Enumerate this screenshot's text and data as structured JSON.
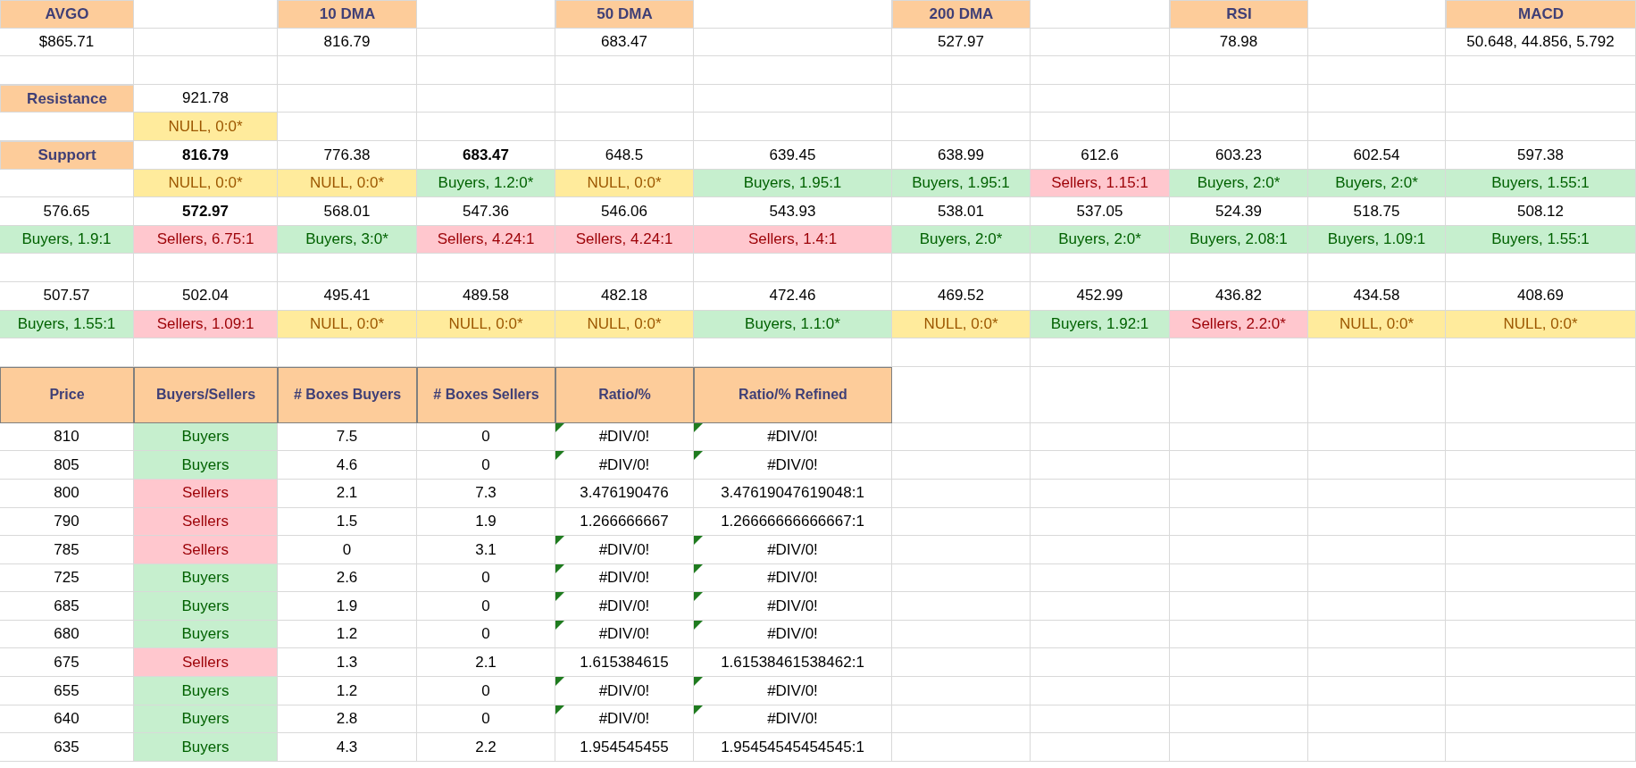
{
  "grid_rows": [
    {
      "cells": [
        {
          "text": "AVGO",
          "kind": "header"
        },
        null,
        {
          "text": "10 DMA",
          "kind": "header"
        },
        null,
        {
          "text": "50 DMA",
          "kind": "header"
        },
        null,
        {
          "text": "200 DMA",
          "kind": "header"
        },
        null,
        {
          "text": "RSI",
          "kind": "header"
        },
        null,
        {
          "text": "MACD",
          "kind": "header"
        }
      ]
    },
    {
      "cells": [
        {
          "text": "$865.71",
          "kind": "plain"
        },
        null,
        {
          "text": "816.79",
          "kind": "plain"
        },
        null,
        {
          "text": "683.47",
          "kind": "plain"
        },
        null,
        {
          "text": "527.97",
          "kind": "plain"
        },
        null,
        {
          "text": "78.98",
          "kind": "plain"
        },
        null,
        {
          "text": "50.648, 44.856, 5.792",
          "kind": "plain"
        }
      ]
    },
    {
      "cells": [
        null,
        null,
        null,
        null,
        null,
        null,
        null,
        null,
        null,
        null,
        null
      ]
    },
    {
      "cells": [
        {
          "text": "Resistance",
          "kind": "header"
        },
        {
          "text": "921.78",
          "kind": "plain"
        },
        null,
        null,
        null,
        null,
        null,
        null,
        null,
        null,
        null
      ]
    },
    {
      "cells": [
        null,
        {
          "text": "NULL, 0:0*",
          "kind": "neutral"
        },
        null,
        null,
        null,
        null,
        null,
        null,
        null,
        null,
        null
      ]
    },
    {
      "cells": [
        {
          "text": "Support",
          "kind": "header"
        },
        {
          "text": "816.79",
          "kind": "bold"
        },
        {
          "text": "776.38",
          "kind": "plain"
        },
        {
          "text": "683.47",
          "kind": "bold"
        },
        {
          "text": "648.5",
          "kind": "plain"
        },
        {
          "text": "639.45",
          "kind": "plain"
        },
        {
          "text": "638.99",
          "kind": "plain"
        },
        {
          "text": "612.6",
          "kind": "plain"
        },
        {
          "text": "603.23",
          "kind": "plain"
        },
        {
          "text": "602.54",
          "kind": "plain"
        },
        {
          "text": "597.38",
          "kind": "plain"
        }
      ]
    },
    {
      "cells": [
        null,
        {
          "text": "NULL, 0:0*",
          "kind": "neutral"
        },
        {
          "text": "NULL, 0:0*",
          "kind": "neutral"
        },
        {
          "text": "Buyers, 1.2:0*",
          "kind": "buyers"
        },
        {
          "text": "NULL, 0:0*",
          "kind": "neutral"
        },
        {
          "text": "Buyers, 1.95:1",
          "kind": "buyers"
        },
        {
          "text": "Buyers, 1.95:1",
          "kind": "buyers"
        },
        {
          "text": "Sellers, 1.15:1",
          "kind": "sellers"
        },
        {
          "text": "Buyers, 2:0*",
          "kind": "buyers"
        },
        {
          "text": "Buyers, 2:0*",
          "kind": "buyers"
        },
        {
          "text": "Buyers, 1.55:1",
          "kind": "buyers"
        }
      ]
    },
    {
      "cells": [
        {
          "text": "576.65",
          "kind": "plain"
        },
        {
          "text": "572.97",
          "kind": "bold"
        },
        {
          "text": "568.01",
          "kind": "plain"
        },
        {
          "text": "547.36",
          "kind": "plain"
        },
        {
          "text": "546.06",
          "kind": "plain"
        },
        {
          "text": "543.93",
          "kind": "plain"
        },
        {
          "text": "538.01",
          "kind": "plain"
        },
        {
          "text": "537.05",
          "kind": "plain"
        },
        {
          "text": "524.39",
          "kind": "plain"
        },
        {
          "text": "518.75",
          "kind": "plain"
        },
        {
          "text": "508.12",
          "kind": "plain"
        }
      ]
    },
    {
      "cells": [
        {
          "text": "Buyers, 1.9:1",
          "kind": "buyers"
        },
        {
          "text": "Sellers, 6.75:1",
          "kind": "sellers"
        },
        {
          "text": "Buyers, 3:0*",
          "kind": "buyers"
        },
        {
          "text": "Sellers, 4.24:1",
          "kind": "sellers"
        },
        {
          "text": "Sellers, 4.24:1",
          "kind": "sellers"
        },
        {
          "text": "Sellers, 1.4:1",
          "kind": "sellers"
        },
        {
          "text": "Buyers, 2:0*",
          "kind": "buyers"
        },
        {
          "text": "Buyers, 2:0*",
          "kind": "buyers"
        },
        {
          "text": "Buyers, 2.08:1",
          "kind": "buyers"
        },
        {
          "text": "Buyers, 1.09:1",
          "kind": "buyers"
        },
        {
          "text": "Buyers, 1.55:1",
          "kind": "buyers"
        }
      ]
    },
    {
      "cells": [
        null,
        null,
        null,
        null,
        null,
        null,
        null,
        null,
        null,
        null,
        null
      ]
    },
    {
      "cells": [
        {
          "text": "507.57",
          "kind": "plain"
        },
        {
          "text": "502.04",
          "kind": "plain"
        },
        {
          "text": "495.41",
          "kind": "plain"
        },
        {
          "text": "489.58",
          "kind": "plain"
        },
        {
          "text": "482.18",
          "kind": "plain"
        },
        {
          "text": "472.46",
          "kind": "plain"
        },
        {
          "text": "469.52",
          "kind": "plain"
        },
        {
          "text": "452.99",
          "kind": "plain"
        },
        {
          "text": "436.82",
          "kind": "plain"
        },
        {
          "text": "434.58",
          "kind": "plain"
        },
        {
          "text": "408.69",
          "kind": "plain"
        }
      ]
    },
    {
      "cells": [
        {
          "text": "Buyers, 1.55:1",
          "kind": "buyers"
        },
        {
          "text": "Sellers, 1.09:1",
          "kind": "sellers"
        },
        {
          "text": "NULL, 0:0*",
          "kind": "neutral"
        },
        {
          "text": "NULL, 0:0*",
          "kind": "neutral"
        },
        {
          "text": "NULL, 0:0*",
          "kind": "neutral"
        },
        {
          "text": "Buyers, 1.1:0*",
          "kind": "buyers"
        },
        {
          "text": "NULL, 0:0*",
          "kind": "neutral"
        },
        {
          "text": "Buyers, 1.92:1",
          "kind": "buyers"
        },
        {
          "text": "Sellers, 2.2:0*",
          "kind": "sellers"
        },
        {
          "text": "NULL, 0:0*",
          "kind": "neutral"
        },
        {
          "text": "NULL, 0:0*",
          "kind": "neutral"
        }
      ]
    },
    {
      "cells": [
        null,
        null,
        null,
        null,
        null,
        null,
        null,
        null,
        null,
        null,
        null
      ]
    }
  ],
  "table": {
    "columns": [
      "Price",
      "Buyers/Sellers",
      "# Boxes Buyers",
      "# Boxes Sellers",
      "Ratio/%",
      "Ratio/% Refined"
    ],
    "rows": [
      {
        "price": "810",
        "side": {
          "text": "Buyers",
          "kind": "buyers"
        },
        "boxes_buyers": "7.5",
        "boxes_sellers": "0",
        "ratio": "#DIV/0!",
        "ratio_refined": "#DIV/0!",
        "error_flag": true
      },
      {
        "price": "805",
        "side": {
          "text": "Buyers",
          "kind": "buyers"
        },
        "boxes_buyers": "4.6",
        "boxes_sellers": "0",
        "ratio": "#DIV/0!",
        "ratio_refined": "#DIV/0!",
        "error_flag": true
      },
      {
        "price": "800",
        "side": {
          "text": "Sellers",
          "kind": "sellers"
        },
        "boxes_buyers": "2.1",
        "boxes_sellers": "7.3",
        "ratio": "3.476190476",
        "ratio_refined": "3.47619047619048:1",
        "error_flag": false
      },
      {
        "price": "790",
        "side": {
          "text": "Sellers",
          "kind": "sellers"
        },
        "boxes_buyers": "1.5",
        "boxes_sellers": "1.9",
        "ratio": "1.266666667",
        "ratio_refined": "1.26666666666667:1",
        "error_flag": false
      },
      {
        "price": "785",
        "side": {
          "text": "Sellers",
          "kind": "sellers"
        },
        "boxes_buyers": "0",
        "boxes_sellers": "3.1",
        "ratio": "#DIV/0!",
        "ratio_refined": "#DIV/0!",
        "error_flag": true
      },
      {
        "price": "725",
        "side": {
          "text": "Buyers",
          "kind": "buyers"
        },
        "boxes_buyers": "2.6",
        "boxes_sellers": "0",
        "ratio": "#DIV/0!",
        "ratio_refined": "#DIV/0!",
        "error_flag": true
      },
      {
        "price": "685",
        "side": {
          "text": "Buyers",
          "kind": "buyers"
        },
        "boxes_buyers": "1.9",
        "boxes_sellers": "0",
        "ratio": "#DIV/0!",
        "ratio_refined": "#DIV/0!",
        "error_flag": true
      },
      {
        "price": "680",
        "side": {
          "text": "Buyers",
          "kind": "buyers"
        },
        "boxes_buyers": "1.2",
        "boxes_sellers": "0",
        "ratio": "#DIV/0!",
        "ratio_refined": "#DIV/0!",
        "error_flag": true
      },
      {
        "price": "675",
        "side": {
          "text": "Sellers",
          "kind": "sellers"
        },
        "boxes_buyers": "1.3",
        "boxes_sellers": "2.1",
        "ratio": "1.615384615",
        "ratio_refined": "1.61538461538462:1",
        "error_flag": false
      },
      {
        "price": "655",
        "side": {
          "text": "Buyers",
          "kind": "buyers"
        },
        "boxes_buyers": "1.2",
        "boxes_sellers": "0",
        "ratio": "#DIV/0!",
        "ratio_refined": "#DIV/0!",
        "error_flag": true
      },
      {
        "price": "640",
        "side": {
          "text": "Buyers",
          "kind": "buyers"
        },
        "boxes_buyers": "2.8",
        "boxes_sellers": "0",
        "ratio": "#DIV/0!",
        "ratio_refined": "#DIV/0!",
        "error_flag": true
      },
      {
        "price": "635",
        "side": {
          "text": "Buyers",
          "kind": "buyers"
        },
        "boxes_buyers": "4.3",
        "boxes_sellers": "2.2",
        "ratio": "1.954545455",
        "ratio_refined": "1.95454545454545:1",
        "error_flag": false
      }
    ]
  }
}
